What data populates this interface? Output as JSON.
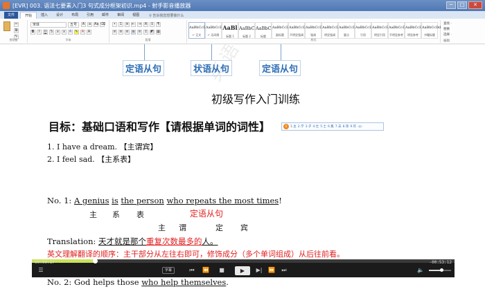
{
  "window": {
    "title": "[EVR] 003. 语法七要素入门3 句式成分框架初识.mp4 - 射手影音播放器",
    "buttons": [
      "─",
      "□",
      "✕"
    ]
  },
  "ribbon": {
    "file_tab": "文件",
    "tabs": [
      "开始",
      "插入",
      "设计",
      "布局",
      "引用",
      "邮件",
      "审阅",
      "视图"
    ],
    "active_tab": "开始",
    "tell_me": "♀ 告诉我您想要做什么",
    "groups": {
      "clipboard": "剪贴板",
      "font": "字体",
      "paragraph": "段落",
      "styles": "样式",
      "editing": "编辑"
    },
    "font_name": "宋体",
    "font_size": "五号",
    "styles": [
      {
        "sample": "AaBbCcDd",
        "name": "↵ 正文"
      },
      {
        "sample": "AaBbCcDd",
        "name": "↵ 无间隔"
      },
      {
        "sample": "AaBl",
        "name": "标题 1"
      },
      {
        "sample": "AaBbC",
        "name": "标题 2"
      },
      {
        "sample": "AaBbC",
        "name": "标题"
      },
      {
        "sample": "AaBbCcD",
        "name": "副标题"
      },
      {
        "sample": "AaBbCcDd",
        "name": "不明显强调"
      },
      {
        "sample": "AaBbCcDd",
        "name": "强调"
      },
      {
        "sample": "AaBbCcDd",
        "name": "明显强调"
      },
      {
        "sample": "AaBbCcDd",
        "name": "要点"
      },
      {
        "sample": "AaBbCcDd",
        "name": "引用"
      },
      {
        "sample": "AaBbCcDd",
        "name": "明显引用"
      },
      {
        "sample": "AaBbCcDd",
        "name": "不明显参考"
      },
      {
        "sample": "AaBbCcDd",
        "name": "明显参考"
      },
      {
        "sample": "AaBbCcDd",
        "name": "书籍标题"
      }
    ],
    "editing": [
      "查找 ·",
      "替换",
      "选择 ·"
    ]
  },
  "callouts": [
    "定语从句",
    "状语从句",
    "定语从句"
  ],
  "document": {
    "heading": "初级写作入门训练",
    "goal": "目标：基础口语和写作【请根据单词的词性】",
    "ex1": "1. I have a dream. 【主谓宾】",
    "ex2": "2. I feel sad. 【主系表】",
    "no1_label": "No. 1: ",
    "no1_parts": [
      "A genius",
      "is",
      "the person",
      "who repeats the most times",
      "!"
    ],
    "no1_roles": [
      "主",
      "系",
      "表"
    ],
    "no1_clause_label": "定语从句",
    "no1_sub_roles": [
      "主",
      "谓",
      "定",
      "宾"
    ],
    "translation_label": "Translation:",
    "translation_parts": [
      "天才就是那个",
      "重复次数最多的",
      "人。"
    ],
    "tip": "英文理解翻译的顺序：主干部分从左往右即可，修饰成分（多个单词组成）从后往前看。",
    "no2_label": "No. 2: God helps those ",
    "no2_clause": "who help themselves",
    "no2_end": "."
  },
  "ime": {
    "logo": "S",
    "candidates": [
      "1.主",
      "2.学",
      "3.子",
      "4.仕",
      "5.士",
      "6.集",
      "7.去",
      "8.等",
      "9.年",
      "◁▷"
    ]
  },
  "watermark": "英语语法速成秘籍",
  "player": {
    "elapsed": "00:09:17",
    "remaining": "-00:53:12",
    "subtitle_label": "字幕",
    "progress_fraction": 0.149,
    "volume_fraction": 0.55
  }
}
